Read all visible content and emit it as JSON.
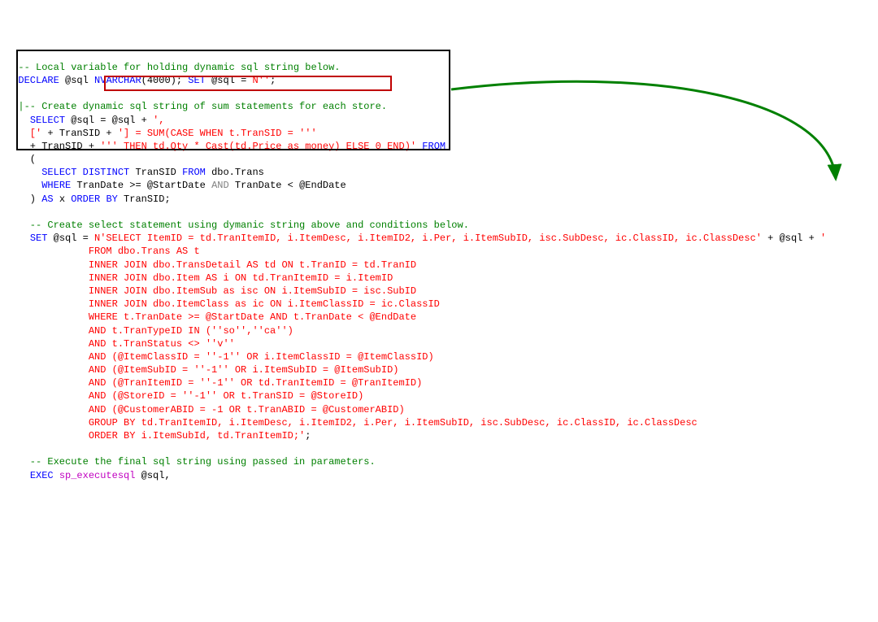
{
  "code": {
    "c1a": "  -- Local variable for holding dynamic sql string below.",
    "l2_declare": "DECLARE",
    "l2_var": " @sql ",
    "l2_type": "NVARCHAR",
    "l2_paren_open": "(",
    "l2_num": "4000",
    "l2_rest": "); ",
    "l2_set": "SET",
    "l2_eq": " @sql = ",
    "l2_str": "N''",
    "l2_semi": ";",
    "c2": "  |-- Create dynamic sql string of sum statements for each store.",
    "l5_sel": "SELECT",
    "l5_rest": " @sql = @sql + ",
    "l5_str": "',",
    "l6_str1": "    ['",
    "l6_plus1": " + TranSID + ",
    "l6_str2": "'] = SUM(CASE WHEN t.TranSID = '''",
    "l7_plus": "    + TranSID + ",
    "l7_str1": "''' ",
    "l7_hl": "THEN td.Qty * Cast(td.Price as money) ELSE 0 END)'",
    "l7_from": " FROM",
    "l8_p": "    (",
    "l9_sel": "SELECT",
    "l9_dist": " DISTINCT",
    "l9_rest": " TranSID ",
    "l9_from": "FROM",
    "l9_tbl": " dbo.Trans",
    "l10_where": "WHERE",
    "l10_a": " TranDate >= @StartDate ",
    "l10_and": "AND",
    "l10_b": " TranDate < @EndDate",
    "l11_p": "    ) ",
    "l11_as": "AS",
    "l11_x": " x ",
    "l11_ob": "ORDER BY",
    "l11_rest": " TranSID;",
    "c3": "    -- Create select statement using dymanic string above and conditions below.",
    "l14_set": "SET",
    "l14_var": " @sql = ",
    "l14_str": "N'SELECT ItemID = td.TranItemID, i.ItemDesc, i.ItemID2, i.Per, i.ItemSubID, isc.SubDesc, ic.ClassID, ic.ClassDesc'",
    "l14_plus": " + @sql + ",
    "l14_str2": "'",
    "l15": "              FROM dbo.Trans AS t",
    "l16": "              INNER JOIN dbo.TransDetail AS td ON t.TranID = td.TranID",
    "l17": "              INNER JOIN dbo.Item AS i ON td.TranItemID = i.ItemID",
    "l18": "              INNER JOIN dbo.ItemSub as isc ON i.ItemSubID = isc.SubID",
    "l19": "              INNER JOIN dbo.ItemClass as ic ON i.ItemClassID = ic.ClassID",
    "l20": "              WHERE t.TranDate >= @StartDate AND t.TranDate < @EndDate",
    "l21": "              AND t.TranTypeID IN (''so'',''ca'')",
    "l22": "              AND t.TranStatus <> ''v''",
    "l23": "              AND (@ItemClassID = ''-1'' OR i.ItemClassID = @ItemClassID)",
    "l24": "              AND (@ItemSubID = ''-1'' OR i.ItemSubID = @ItemSubID)",
    "l25": "              AND (@TranItemID = ''-1'' OR td.TranItemID = @TranItemID)",
    "l26": "              AND (@StoreID = ''-1'' OR t.TranSID = @StoreID)",
    "l27": "              AND (@CustomerABID = -1 OR t.TranABID = @CustomerABID)",
    "l28": "              GROUP BY td.TranItemID, i.ItemDesc, i.ItemID2, i.Per, i.ItemSubID, isc.SubDesc, ic.ClassID, ic.ClassDesc",
    "l29": "              ORDER BY i.ItemSubId, td.TranItemID;'",
    "l29_semi": ";",
    "c4": "    -- Execute the final sql string using passed in parameters.",
    "l31_exec": "EXEC",
    "l31_sp": " sp_executesql",
    "l31_rest": " @sql,"
  }
}
